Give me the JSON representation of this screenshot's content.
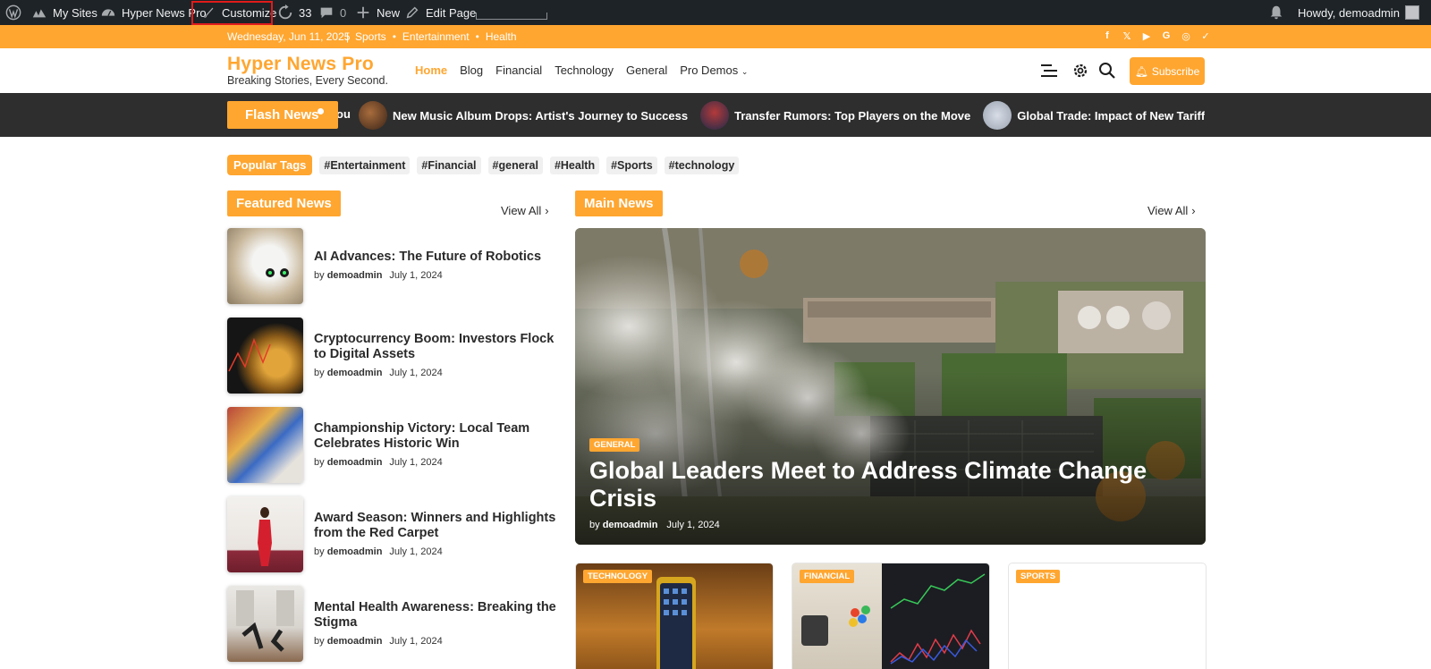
{
  "adminbar": {
    "my_sites": "My Sites",
    "site_name": "Hyper News Pro",
    "customize": "Customize",
    "updates_count": "33",
    "comments_count": "0",
    "new": "New",
    "edit_page": "Edit Page",
    "howdy": "Howdy, demoadmin"
  },
  "topbar": {
    "date": "Wednesday, Jun 11, 2025",
    "separator": "|",
    "links": [
      "Sports",
      "Entertainment",
      "Health"
    ],
    "social_icons": [
      "facebook-icon",
      "x-icon",
      "youtube-icon",
      "google-icon",
      "instagram-icon",
      "vk-icon"
    ]
  },
  "header": {
    "logo_title": "Hyper News Pro",
    "logo_tagline": "Breaking Stories, Every Second.",
    "nav": [
      "Home",
      "Blog",
      "Financial",
      "Technology",
      "General",
      "Pro Demos"
    ],
    "subscribe": "Subscribe"
  },
  "flash": {
    "label": "Flash News",
    "cut_text": "ou",
    "items": [
      "New Music Album Drops: Artist's Journey to Success",
      "Transfer Rumors: Top Players on the Move",
      "Global Trade: Impact of New Tariffs on M"
    ]
  },
  "tags": {
    "label": "Popular Tags",
    "items": [
      "#Entertainment",
      "#Financial",
      "#general",
      "#Health",
      "#Sports",
      "#technology"
    ]
  },
  "featured": {
    "label": "Featured News",
    "view_all": "View All",
    "items": [
      {
        "title": "AI Advances: The Future of Robotics",
        "author": "demoadmin",
        "date": "July 1, 2024"
      },
      {
        "title": "Cryptocurrency Boom: Investors Flock to Digital Assets",
        "author": "demoadmin",
        "date": "July 1, 2024"
      },
      {
        "title": "Championship Victory: Local Team Celebrates Historic Win",
        "author": "demoadmin",
        "date": "July 1, 2024"
      },
      {
        "title": "Award Season: Winners and Highlights from the Red Carpet",
        "author": "demoadmin",
        "date": "July 1, 2024"
      },
      {
        "title": "Mental Health Awareness: Breaking the Stigma",
        "author": "demoadmin",
        "date": "July 1, 2024"
      }
    ],
    "by": "by"
  },
  "main": {
    "label": "Main News",
    "view_all": "View All",
    "hero": {
      "category": "GENERAL",
      "title": "Global Leaders Meet to Address Climate Change Crisis",
      "author": "demoadmin",
      "date": "July 1, 2024"
    },
    "cards": [
      {
        "category": "TECHNOLOGY"
      },
      {
        "category": "FINANCIAL"
      },
      {
        "category": "SPORTS"
      }
    ]
  },
  "colors": {
    "accent": "#ffa630",
    "adminbar": "#1d2327",
    "flashbar": "#2e2e2e"
  }
}
